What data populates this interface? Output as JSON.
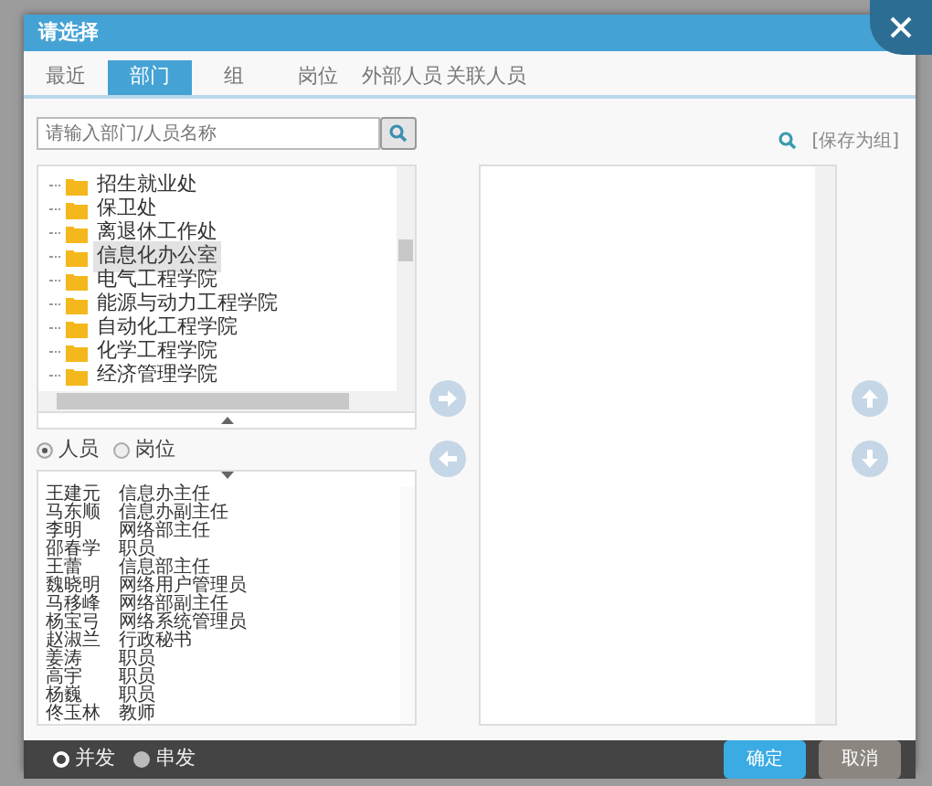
{
  "window": {
    "title": "请选择"
  },
  "tabs": [
    {
      "label": "最近",
      "selected": false
    },
    {
      "label": "部门",
      "selected": true
    },
    {
      "label": "组",
      "selected": false
    },
    {
      "label": "岗位",
      "selected": false
    },
    {
      "label": "外部人员",
      "selected": false
    },
    {
      "label": "关联人员",
      "selected": false
    }
  ],
  "search": {
    "placeholder": "请输入部门/人员名称"
  },
  "department_tree": [
    {
      "label": "招生就业处",
      "selected": false
    },
    {
      "label": "保卫处",
      "selected": false
    },
    {
      "label": "离退休工作处",
      "selected": false
    },
    {
      "label": "信息化办公室",
      "selected": true
    },
    {
      "label": "电气工程学院",
      "selected": false
    },
    {
      "label": "能源与动力工程学院",
      "selected": false
    },
    {
      "label": "自动化工程学院",
      "selected": false
    },
    {
      "label": "化学工程学院",
      "selected": false
    },
    {
      "label": "经济管理学院",
      "selected": false
    }
  ],
  "view_mode": [
    {
      "label": "人员",
      "selected": true
    },
    {
      "label": "岗位",
      "selected": false
    }
  ],
  "people": [
    {
      "name": "王建元",
      "position": "信息办主任"
    },
    {
      "name": "马东顺",
      "position": "信息办副主任"
    },
    {
      "name": "李明",
      "position": "网络部主任"
    },
    {
      "name": "邵春学",
      "position": "职员"
    },
    {
      "name": "王蕾",
      "position": "信息部主任"
    },
    {
      "name": "魏晓明",
      "position": "网络用户管理员"
    },
    {
      "name": "马移峰",
      "position": "网络部副主任"
    },
    {
      "name": "杨宝弓",
      "position": "网络系统管理员"
    },
    {
      "name": "赵淑兰",
      "position": "行政秘书"
    },
    {
      "name": "姜涛",
      "position": "职员"
    },
    {
      "name": "高宇",
      "position": "职员"
    },
    {
      "name": "杨巍",
      "position": "职员"
    },
    {
      "name": "佟玉林",
      "position": "教师"
    }
  ],
  "save_group": "[保存为组]",
  "send_mode": [
    {
      "label": "并发",
      "selected": true
    },
    {
      "label": "串发",
      "selected": false
    }
  ],
  "buttons": [
    {
      "label": "确定",
      "kind": "primary"
    },
    {
      "label": "取消",
      "kind": "secondary"
    }
  ]
}
